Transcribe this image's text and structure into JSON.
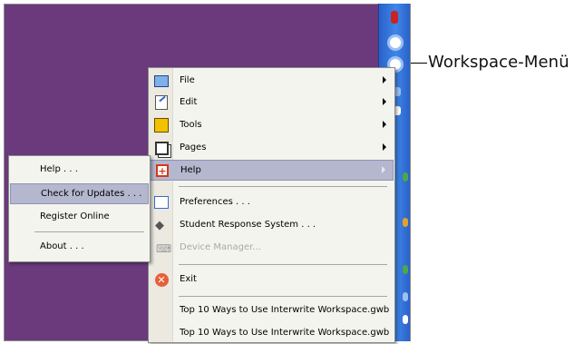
{
  "callout": {
    "text": "Workspace-Menü"
  },
  "main_menu": {
    "file": "File",
    "edit": "Edit",
    "tools": "Tools",
    "pages": "Pages",
    "help": "Help",
    "preferences": "Preferences . . .",
    "student_response": "Student Response System . . .",
    "device_manager": "Device Manager...",
    "exit": "Exit",
    "recent_1": "Top 10 Ways to Use Interwrite Workspace.gwb",
    "recent_2": "Top 10 Ways to Use Interwrite Workspace.gwb"
  },
  "help_submenu": {
    "help": "Help . . .",
    "check_updates": "Check for Updates . . .",
    "register": "Register Online",
    "about": "About . . ."
  },
  "colors": {
    "desktop": "#6b3a7c",
    "toolbar": "#3f86e8",
    "highlight": "#b4b7cd"
  }
}
